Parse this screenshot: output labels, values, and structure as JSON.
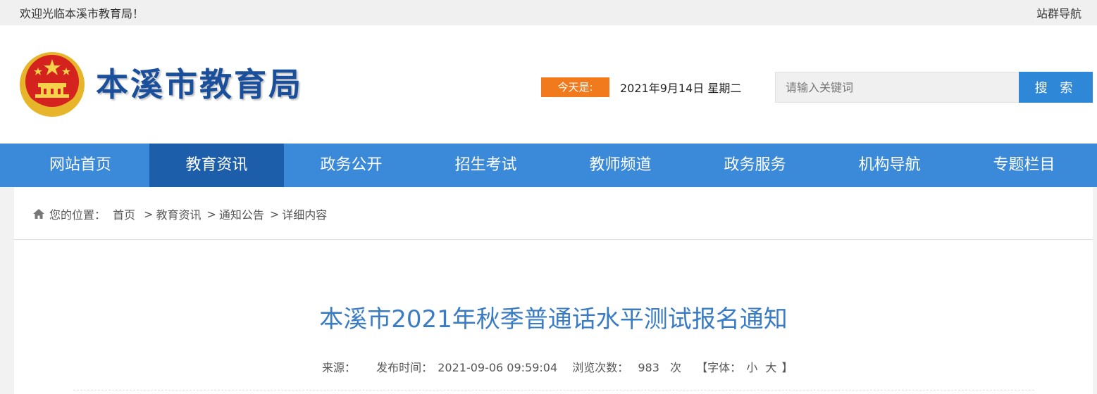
{
  "topbar": {
    "welcome": "欢迎光临本溪市教育局！",
    "site_nav": "站群导航"
  },
  "header": {
    "site_title": "本溪市教育局",
    "today_label": "今天是:",
    "today_date": "2021年9月14日 星期二",
    "search_placeholder": "请输入关键词",
    "search_button": "搜 索"
  },
  "nav": {
    "items": [
      {
        "label": "网站首页"
      },
      {
        "label": "教育资讯"
      },
      {
        "label": "政务公开"
      },
      {
        "label": "招生考试"
      },
      {
        "label": "教师频道"
      },
      {
        "label": "政务服务"
      },
      {
        "label": "机构导航"
      },
      {
        "label": "专题栏目"
      }
    ],
    "active": "教育资讯"
  },
  "breadcrumb": {
    "prefix": "您的位置：",
    "items": [
      "首页",
      "教育资讯",
      "通知公告",
      "详细内容"
    ],
    "separator": ">"
  },
  "article": {
    "title": "本溪市2021年秋季普通话水平测试报名通知",
    "source_label": "来源：",
    "publish_label": "发布时间：",
    "publish_time": "2021-09-06 09:59:04",
    "views_label": "浏览次数：",
    "views": "983",
    "views_unit": "次",
    "font_label": "【字体：",
    "font_small": "小",
    "font_large": "大",
    "font_close": "】"
  },
  "colors": {
    "nav_bg": "#3a8ad9",
    "nav_active": "#1c5ea9",
    "accent_orange": "#f07a1c",
    "title_blue": "#3a7cc4"
  }
}
